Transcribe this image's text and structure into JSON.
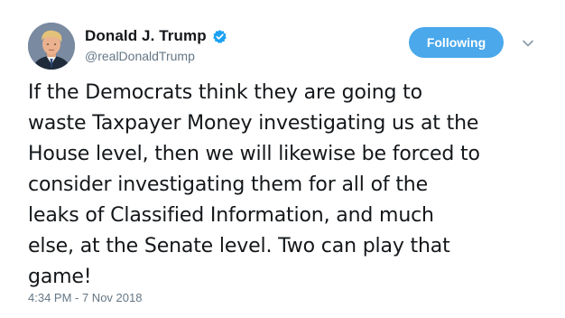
{
  "tweet": {
    "author": {
      "display_name": "Donald J. Trump",
      "handle": "@realDonaldTrump",
      "verified_icon": "verified-badge-icon",
      "avatar_icon": "profile-avatar"
    },
    "follow_button_label": "Following",
    "menu_icon": "chevron-down-icon",
    "text": "If the Democrats think they are going to\nwaste Taxpayer Money investigating us at the\nHouse level, then we will likewise be forced to\nconsider investigating them for all of the\nleaks of Classified Information, and much\nelse, at the Senate level. Two can play that\ngame!",
    "timestamp": "4:34 PM - 7 Nov 2018"
  },
  "colors": {
    "accent": "#4aa8eb",
    "verified": "#1da1f2",
    "secondary_text": "#657786",
    "primary_text": "#14171a"
  }
}
